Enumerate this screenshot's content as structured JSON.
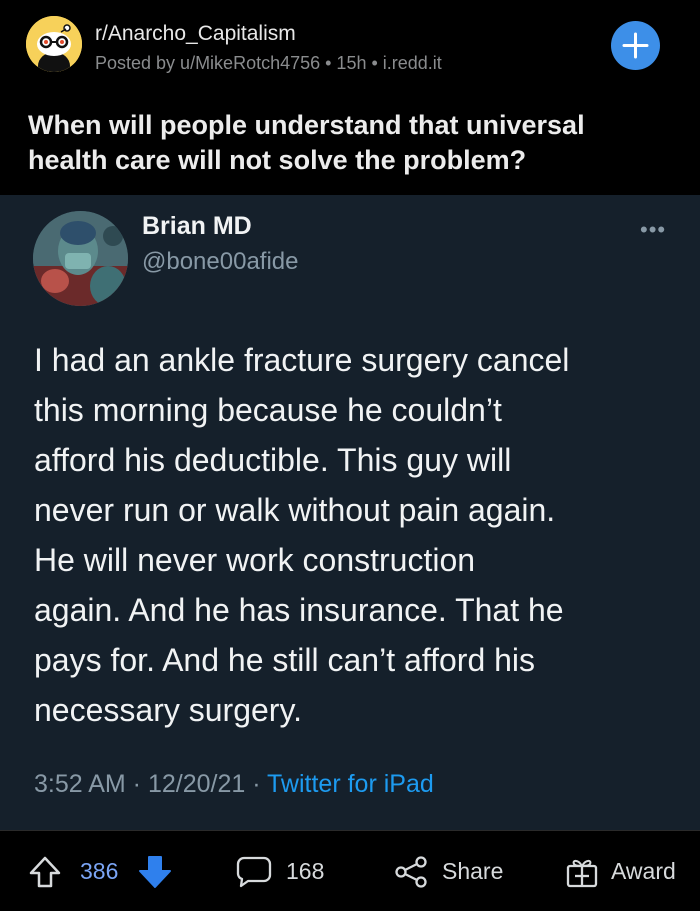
{
  "post": {
    "subreddit": "r/Anarcho_Capitalism",
    "meta": "Posted by u/MikeRotch4756 • 15h • i.redd.it",
    "title": "When will people understand that universal health care will not solve the problem?"
  },
  "tweet": {
    "name": "Brian MD",
    "handle": "@bone00afide",
    "more": "•••",
    "lines": [
      "I had an ankle fracture surgery cancel",
      "this morning because he couldn’t",
      "afford his deductible. This guy will",
      "never run or walk without pain again.",
      "He will never work construction",
      "again.  And he has insurance. That he",
      "pays for.  And he still can’t afford his",
      "necessary surgery."
    ],
    "time": "3:52 AM · 12/20/21 · ",
    "source": "Twitter for iPad"
  },
  "actions": {
    "score": "386",
    "comments": "168",
    "share": "Share",
    "award": "Award"
  },
  "colors": {
    "background": "#000000",
    "tweet_background": "#15202b",
    "join_button": "#3d8fe8",
    "upvote_accent": "#7ba5f5",
    "twitter_link": "#1d9bf0"
  },
  "icons": [
    "join-plus-icon",
    "upvote-arrow-icon",
    "downvote-arrow-icon",
    "comment-bubble-icon",
    "share-icon",
    "award-gift-icon",
    "more-dots-icon"
  ]
}
